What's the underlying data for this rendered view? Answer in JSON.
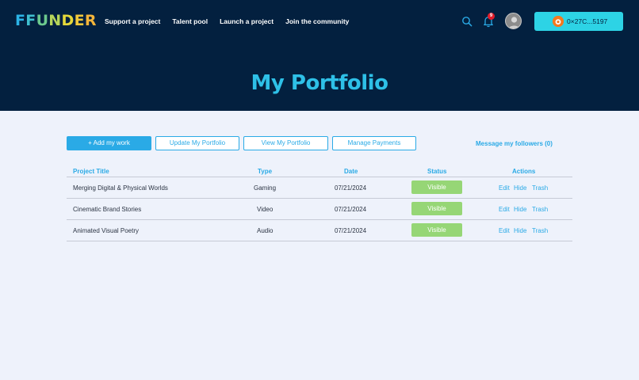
{
  "header": {
    "logo_letters": [
      {
        "char": "F",
        "color": "#2bb3e6"
      },
      {
        "char": "F",
        "color": "#3fbfcf"
      },
      {
        "char": "U",
        "color": "#6cc98e"
      },
      {
        "char": "N",
        "color": "#b6d55a"
      },
      {
        "char": "D",
        "color": "#e5d83a"
      },
      {
        "char": "E",
        "color": "#f2c93a"
      },
      {
        "char": "R",
        "color": "#f5b53a"
      }
    ],
    "nav": [
      "Support a project",
      "Talent pool",
      "Launch a project",
      "Join the community"
    ],
    "notification_count": "9",
    "wallet_address": "0×27C...5197",
    "icons": {
      "search": "search-icon",
      "bell": "bell-icon",
      "avatar": "avatar",
      "wallet": "wallet-icon"
    }
  },
  "page": {
    "title": "My Portfolio"
  },
  "toolbar": {
    "add_label": "+ Add my work",
    "update_label": "Update My Portfolio",
    "view_label": "View My Portfolio",
    "payments_label": "Manage Payments",
    "followers_label": "Message my followers (0)"
  },
  "table": {
    "columns": [
      "Project Title",
      "Type",
      "Date",
      "Status",
      "Actions"
    ],
    "rows": [
      {
        "title": "Merging Digital & Physical Worlds",
        "type": "Gaming",
        "date": "07/21/2024",
        "status": "Visible",
        "actions": [
          "Edit",
          "Hide",
          "Trash"
        ]
      },
      {
        "title": "Cinematic Brand Stories",
        "type": "Video",
        "date": "07/21/2024",
        "status": "Visible",
        "actions": [
          "Edit",
          "Hide",
          "Trash"
        ]
      },
      {
        "title": "Animated Visual Poetry",
        "type": "Audio",
        "date": "07/21/2024",
        "status": "Visible",
        "actions": [
          "Edit",
          "Hide",
          "Trash"
        ]
      }
    ]
  },
  "colors": {
    "header_bg": "#03203f",
    "accent": "#2aaae6",
    "title": "#2ec0e7",
    "wallet_bg": "#2dd3e5",
    "status_visible": "#96d676",
    "page_bg": "#eef2fb"
  }
}
